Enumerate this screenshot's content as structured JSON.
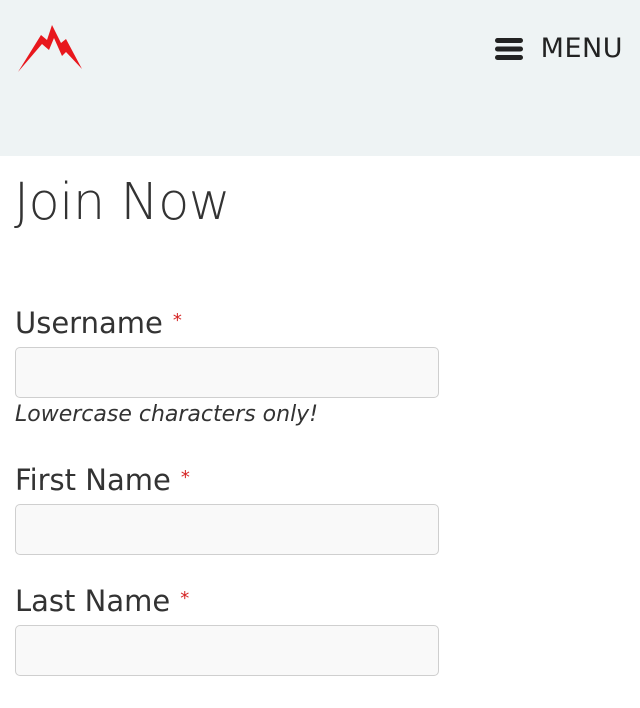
{
  "header": {
    "logo_icon": "mountain-logo-icon",
    "menu_icon": "hamburger-menu-icon",
    "menu_label": "MENU",
    "brand_color": "#e8171d",
    "background": "#eef3f4"
  },
  "page": {
    "title": "Join Now"
  },
  "form": {
    "required_mark": "*",
    "username": {
      "label": "Username",
      "value": "",
      "hint": "Lowercase characters only!"
    },
    "first_name": {
      "label": "First Name",
      "value": ""
    },
    "last_name": {
      "label": "Last Name",
      "value": ""
    }
  }
}
